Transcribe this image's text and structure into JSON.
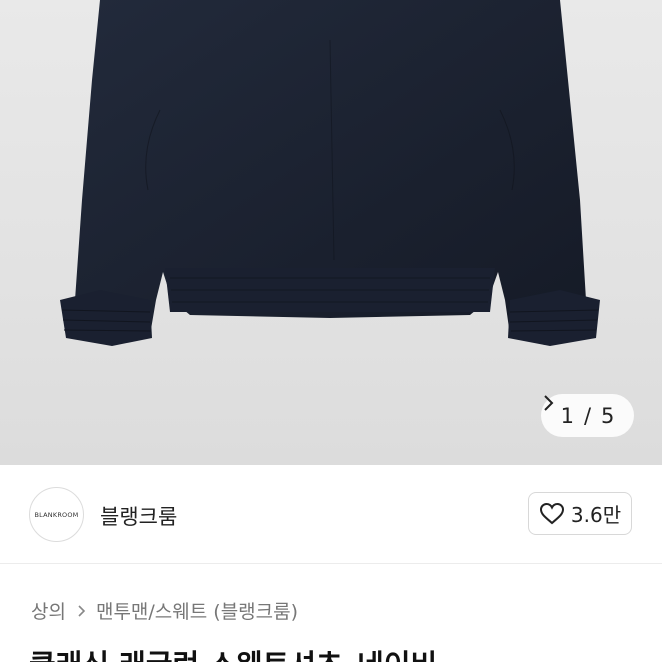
{
  "image": {
    "pager": {
      "current": "1",
      "separator": "/",
      "total": "5",
      "next_icon": "chevron-right-icon"
    }
  },
  "seller": {
    "logo_text": "BLANKROOM",
    "name": "블랭크룸",
    "likes": "3.6만",
    "like_icon": "heart-outline-icon"
  },
  "breadcrumb": {
    "items": [
      "상의",
      "맨투맨/스웨트 (블랭크룸)"
    ]
  },
  "product": {
    "title": "클래식 래글런 스웨트셔츠_네이비"
  },
  "colors": {
    "garment": "#1c2231",
    "background": "#e4e4e4"
  }
}
